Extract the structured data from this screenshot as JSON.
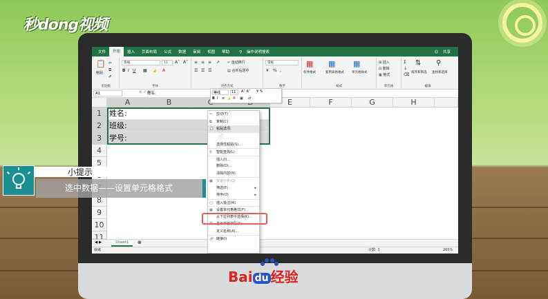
{
  "watermark": "秒dong视频",
  "excel": {
    "menu": [
      "文件",
      "开始",
      "插入",
      "页面布局",
      "公式",
      "数据",
      "审阅",
      "视图",
      "帮助"
    ],
    "active_tab": "开始",
    "tell_me": "操作说明搜索",
    "share": "共享",
    "ribbon_groups": [
      "剪贴板",
      "字体",
      "对齐方式",
      "数字",
      "样式",
      "单元格",
      "编辑"
    ],
    "font_name": "等线",
    "font_size": "11",
    "wrap_text": "自动换行",
    "merge_center": "合并后居中",
    "number_format": "常规",
    "conditional_format": "条件格式",
    "format_as_table": "套用表格格式",
    "cell_styles": "单元格样式",
    "insert": "插入",
    "delete": "删除",
    "format": "格式",
    "sort_filter": "排序和筛选",
    "find_select": "查找和选择",
    "paste": "粘贴",
    "name_box": "A1",
    "formula_value": "姓名:",
    "columns": [
      "A",
      "B",
      "C",
      "D",
      "E",
      "F",
      "G",
      "H"
    ],
    "rows": [
      "1",
      "2",
      "3",
      "4",
      "5",
      "6",
      "7",
      "8",
      "9",
      "10",
      "11"
    ],
    "cells": {
      "A1": "姓名:",
      "A2": "班级:",
      "A3": "学号:"
    },
    "sheet_tab": "Sheet1",
    "status_ready": "就绪",
    "status_count": "计数: 3",
    "zoom": "205%"
  },
  "mini_toolbar": {
    "font": "等线",
    "size": "11"
  },
  "context_menu": [
    {
      "label": "剪切(T)",
      "icon": "scissors-icon",
      "state": "normal"
    },
    {
      "label": "复制(C)",
      "icon": "copy-icon",
      "state": "normal"
    },
    {
      "label": "粘贴选项:",
      "icon": "paste-icon",
      "state": "highlight"
    },
    {
      "label": "选择性粘贴(S)...",
      "icon": "",
      "state": "normal"
    },
    {
      "label": "智能查找(L)",
      "icon": "search-icon",
      "state": "normal"
    },
    {
      "label": "插入(I)...",
      "icon": "",
      "state": "normal"
    },
    {
      "label": "删除(D)...",
      "icon": "",
      "state": "normal"
    },
    {
      "label": "清除内容(N)",
      "icon": "",
      "state": "normal"
    },
    {
      "label": "快速分析(Q)",
      "icon": "analysis-icon",
      "state": "disabled"
    },
    {
      "label": "筛选(E)",
      "icon": "",
      "state": "normal",
      "submenu": true
    },
    {
      "label": "排序(O)",
      "icon": "",
      "state": "normal",
      "submenu": true
    },
    {
      "label": "插入批注(M)",
      "icon": "comment-icon",
      "state": "normal"
    },
    {
      "label": "设置单元格格式(F)...",
      "icon": "format-cells-icon",
      "state": "normal"
    },
    {
      "label": "从下拉列表中选择(K)...",
      "icon": "",
      "state": "normal"
    },
    {
      "label": "显示拼音字段(S)",
      "icon": "pinyin-icon",
      "state": "normal"
    },
    {
      "label": "定义名称(A)...",
      "icon": "",
      "state": "normal"
    },
    {
      "label": "链接(I)",
      "icon": "link-icon",
      "state": "normal"
    }
  ],
  "tip": {
    "title": "小提示",
    "text": "选中数据——设置单元格格式"
  },
  "brand": {
    "bai": "Bai",
    "du": "du",
    "jingyan": "经验"
  }
}
